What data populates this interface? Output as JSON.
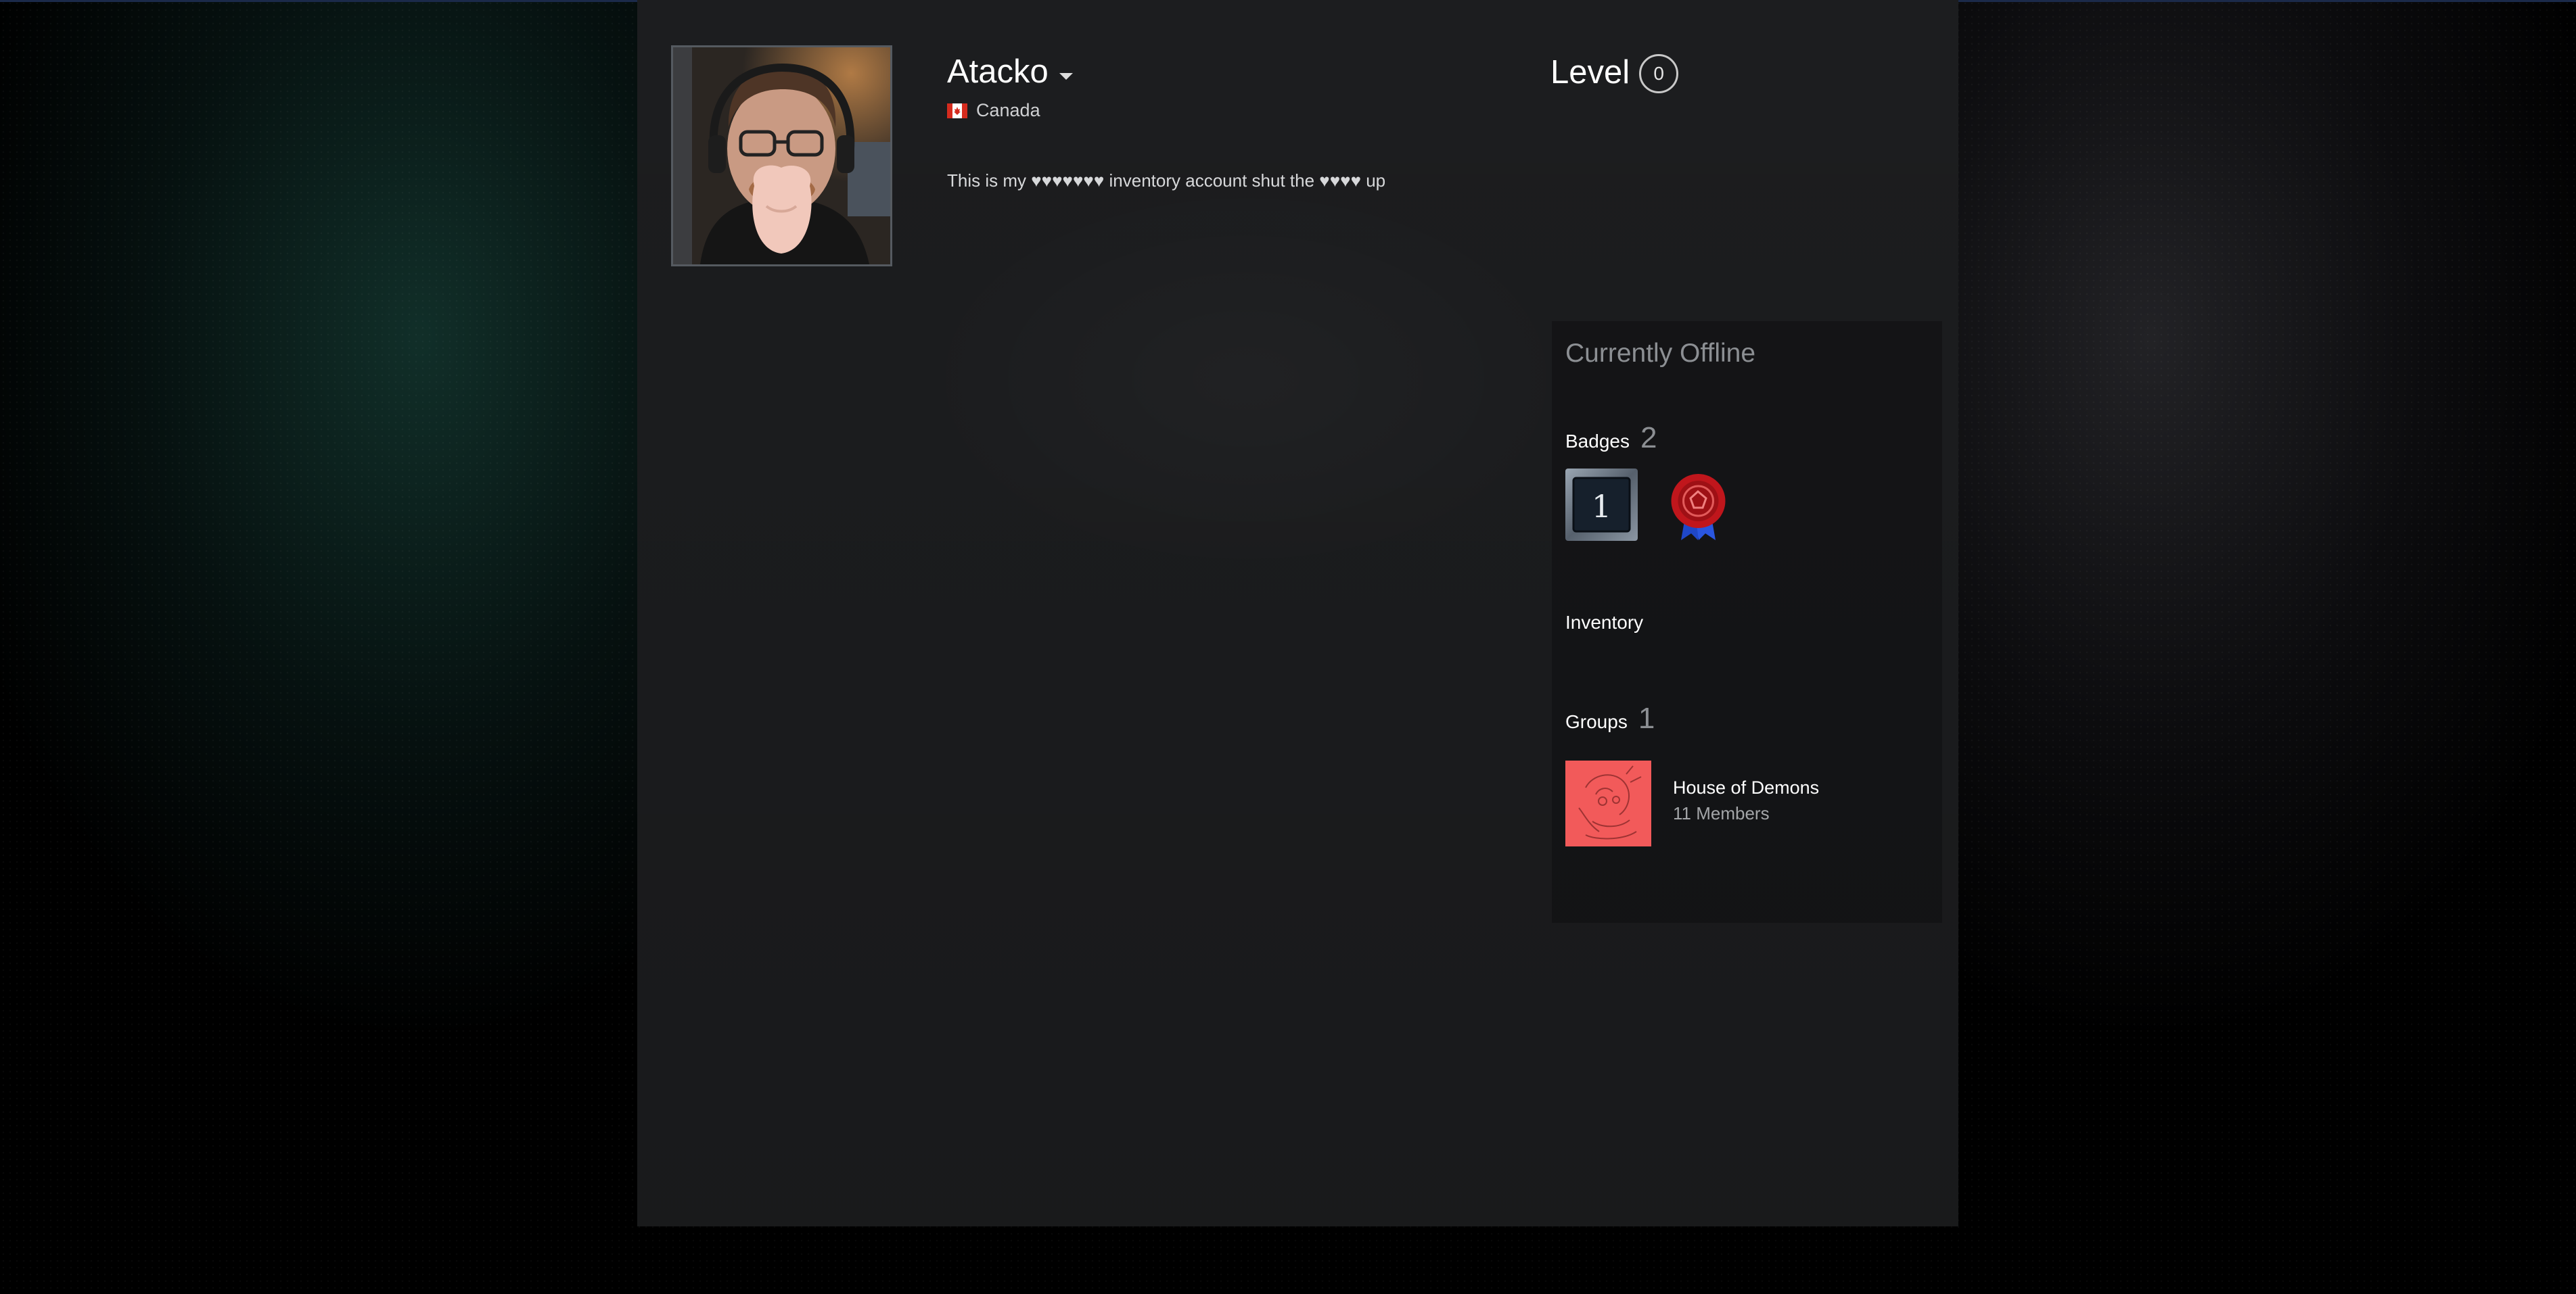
{
  "profile": {
    "name": "Atacko",
    "country": "Canada",
    "summary": "This is my ♥♥♥♥♥♥♥ inventory account shut the ♥♥♥♥ up",
    "level_label": "Level",
    "level_value": "0"
  },
  "sidebar": {
    "status": "Currently Offline",
    "badges": {
      "label": "Badges",
      "count": "2",
      "items": [
        {
          "icon": "years-of-service-badge-icon",
          "text": "1"
        },
        {
          "icon": "wax-seal-ribbon-badge-icon"
        }
      ]
    },
    "inventory": {
      "label": "Inventory"
    },
    "groups": {
      "label": "Groups",
      "count": "1",
      "items": [
        {
          "name": "House of Demons",
          "members": "11 Members"
        }
      ]
    }
  },
  "colors": {
    "panel_bg": "#1c1d1f",
    "status_text": "#8c8f93",
    "group_avatar": "#f25a5a",
    "badge_seal": "#c0161c",
    "badge_ribbon": "#1f47c8"
  }
}
